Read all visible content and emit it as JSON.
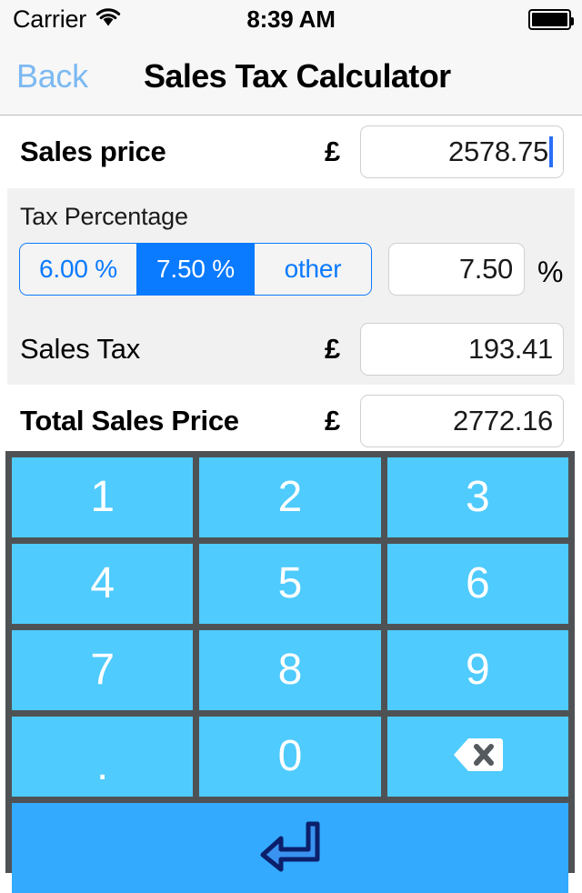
{
  "status_bar": {
    "carrier": "Carrier",
    "wifi_icon": "wifi-icon",
    "time": "8:39 AM",
    "battery_icon": "battery-full-icon"
  },
  "nav_bar": {
    "back_label": "Back",
    "title": "Sales Tax Calculator",
    "back_color": "#7cb9f2"
  },
  "form": {
    "sales_price": {
      "label": "Sales price",
      "currency": "£",
      "value": "2578.75",
      "focused": true
    },
    "tax_section": {
      "title": "Tax Percentage",
      "segments": [
        {
          "label": "6.00 %",
          "selected": false
        },
        {
          "label": "7.50 %",
          "selected": true
        },
        {
          "label": "other",
          "selected": false
        }
      ],
      "percent_value": "7.50",
      "percent_sign": "%",
      "selected_color": "#0a7afe"
    },
    "sales_tax": {
      "label": "Sales Tax",
      "currency": "£",
      "value": "193.41"
    },
    "total": {
      "label": "Total Sales Price",
      "currency": "£",
      "value": "2772.16"
    }
  },
  "keypad": {
    "keys": [
      {
        "label": "1",
        "name": "key-1"
      },
      {
        "label": "2",
        "name": "key-2"
      },
      {
        "label": "3",
        "name": "key-3"
      },
      {
        "label": "4",
        "name": "key-4"
      },
      {
        "label": "5",
        "name": "key-5"
      },
      {
        "label": "6",
        "name": "key-6"
      },
      {
        "label": "7",
        "name": "key-7"
      },
      {
        "label": "8",
        "name": "key-8"
      },
      {
        "label": "9",
        "name": "key-9"
      },
      {
        "label": ".",
        "name": "key-decimal"
      },
      {
        "label": "0",
        "name": "key-0"
      },
      {
        "label": "",
        "name": "key-backspace",
        "icon": "backspace-icon"
      }
    ],
    "return_key": {
      "icon": "return-arrow-icon",
      "name": "key-return"
    },
    "key_color": "#4fcbfd",
    "return_color": "#33aafe",
    "grid_color": "#4f5254"
  }
}
